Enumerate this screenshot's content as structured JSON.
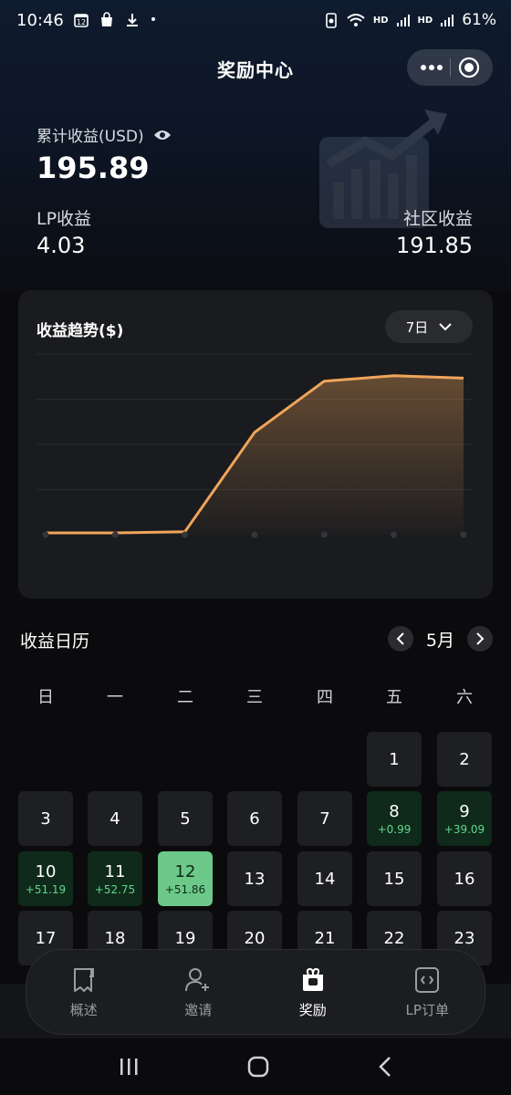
{
  "status": {
    "time": "10:46",
    "calendar_day": "12",
    "battery": "61%",
    "hd1": "HD",
    "hd2": "HD"
  },
  "header": {
    "title": "奖励中心"
  },
  "summary": {
    "total_label": "累计收益(USD)",
    "total_value": "195.89",
    "lp_label": "LP收益",
    "lp_value": "4.03",
    "community_label": "社区收益",
    "community_value": "191.85"
  },
  "chart": {
    "title": "收益趋势($)",
    "range": "7日"
  },
  "chart_data": {
    "type": "area",
    "title": "收益趋势($)",
    "x": [
      1,
      2,
      3,
      4,
      5,
      6,
      7
    ],
    "values": [
      0.3,
      0.3,
      0.5,
      17.0,
      25.5,
      26.4,
      26.0
    ],
    "ylim": [
      0,
      30
    ],
    "grid": true,
    "line_color": "#f0a55a"
  },
  "calendar": {
    "title": "收益日历",
    "month": "5月",
    "weekdays": [
      "日",
      "一",
      "二",
      "三",
      "四",
      "五",
      "六"
    ],
    "days": [
      {
        "n": "1",
        "g": ""
      },
      {
        "n": "2",
        "g": ""
      },
      {
        "n": "3",
        "g": ""
      },
      {
        "n": "4",
        "g": ""
      },
      {
        "n": "5",
        "g": ""
      },
      {
        "n": "6",
        "g": ""
      },
      {
        "n": "7",
        "g": ""
      },
      {
        "n": "8",
        "g": "+0.99"
      },
      {
        "n": "9",
        "g": "+39.09"
      },
      {
        "n": "10",
        "g": "+51.19"
      },
      {
        "n": "11",
        "g": "+52.75"
      },
      {
        "n": "12",
        "g": "+51.86"
      },
      {
        "n": "13",
        "g": ""
      },
      {
        "n": "14",
        "g": ""
      },
      {
        "n": "15",
        "g": ""
      },
      {
        "n": "16",
        "g": ""
      },
      {
        "n": "17",
        "g": ""
      },
      {
        "n": "18",
        "g": ""
      },
      {
        "n": "19",
        "g": ""
      },
      {
        "n": "20",
        "g": ""
      },
      {
        "n": "21",
        "g": ""
      },
      {
        "n": "22",
        "g": ""
      },
      {
        "n": "23",
        "g": ""
      }
    ],
    "today": "12"
  },
  "tabs": [
    {
      "label": "概述",
      "icon": "overview-icon",
      "active": false
    },
    {
      "label": "邀请",
      "icon": "invite-icon",
      "active": false
    },
    {
      "label": "奖励",
      "icon": "rewards-icon",
      "active": true
    },
    {
      "label": "LP订单",
      "icon": "lp-order-icon",
      "active": false
    }
  ],
  "colors": {
    "accent_line": "#f0a55a",
    "gain_green": "#5fd98c",
    "today_bg": "#6cc98a",
    "positive_bg": "#0f2a1a"
  }
}
